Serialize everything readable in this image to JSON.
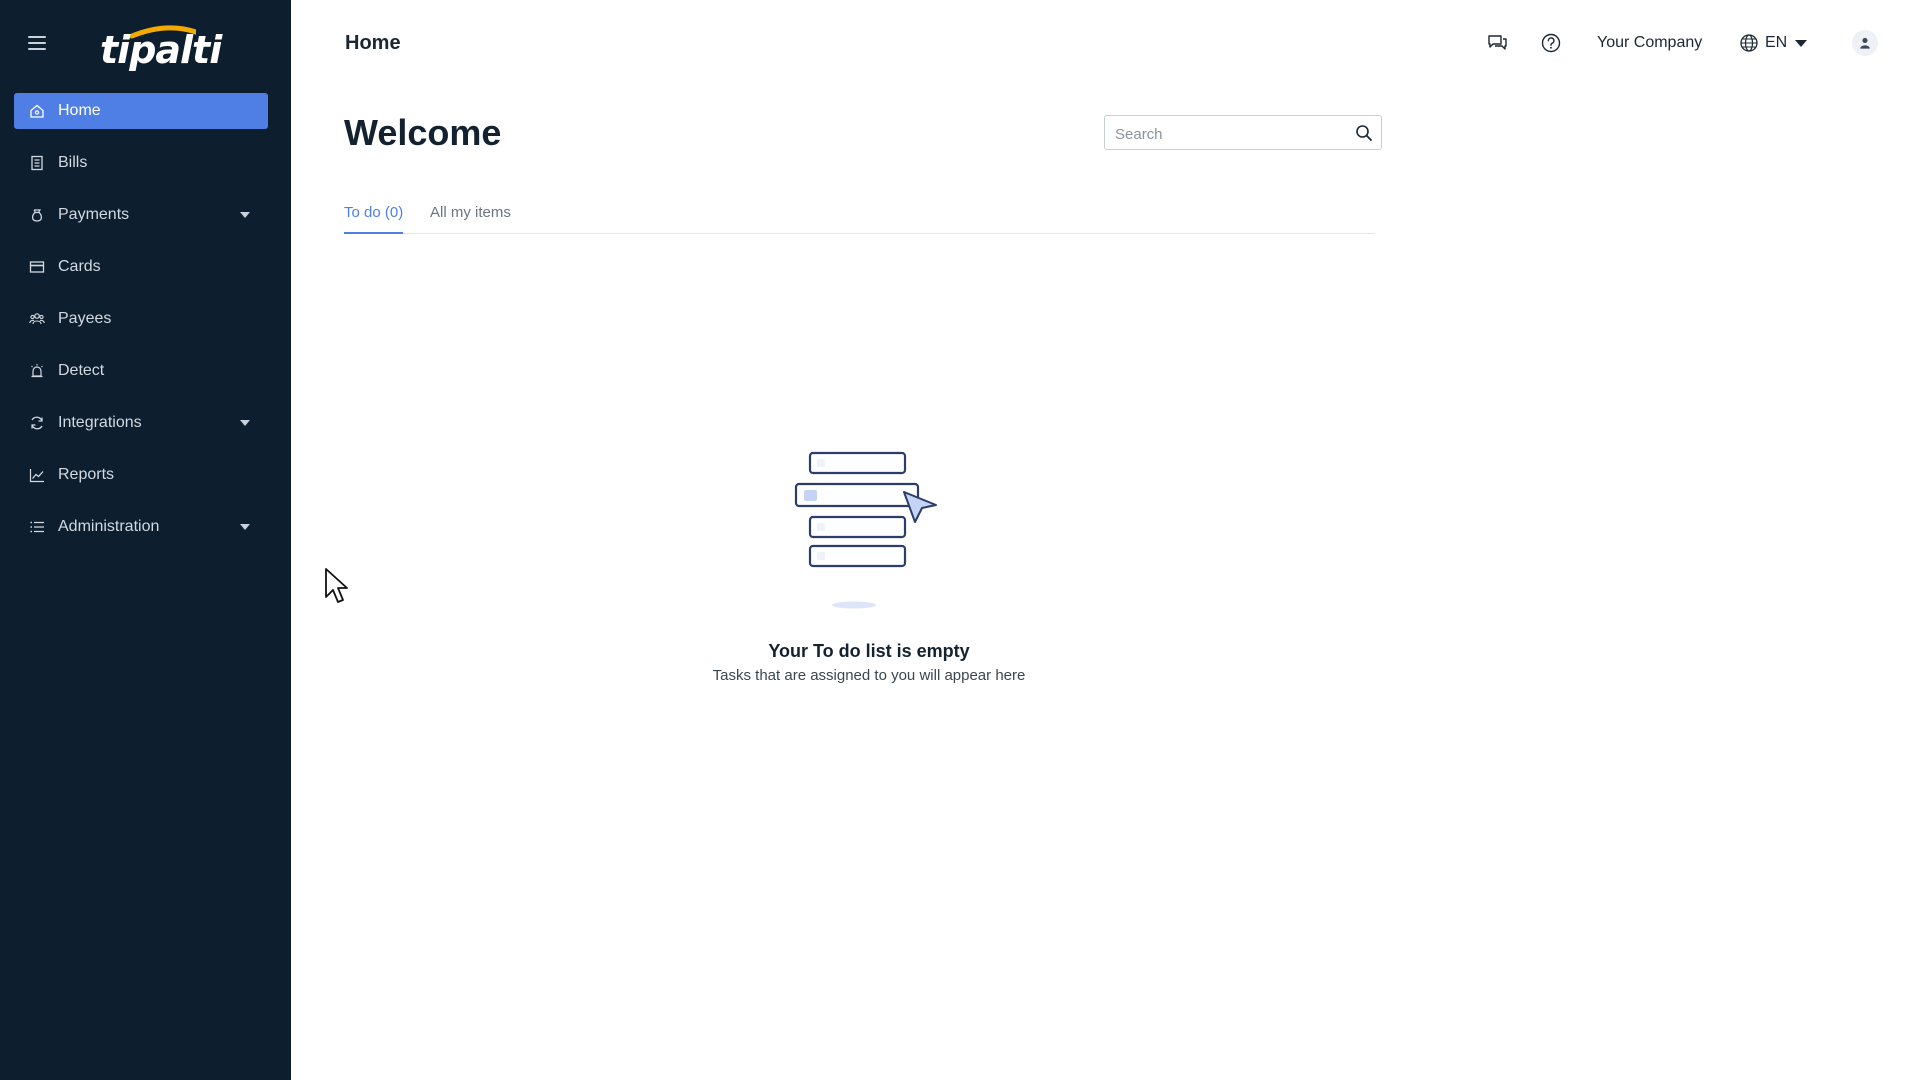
{
  "brand": {
    "logo_text": "tipalti",
    "accent": "#4f7fe5",
    "logo_arc_color": "#f2a900"
  },
  "sidebar": {
    "items": [
      {
        "label": "Home",
        "icon": "home-icon",
        "active": true,
        "has_submenu": false
      },
      {
        "label": "Bills",
        "icon": "bills-icon",
        "active": false,
        "has_submenu": false
      },
      {
        "label": "Payments",
        "icon": "payments-icon",
        "active": false,
        "has_submenu": true
      },
      {
        "label": "Cards",
        "icon": "card-icon",
        "active": false,
        "has_submenu": false
      },
      {
        "label": "Payees",
        "icon": "payees-icon",
        "active": false,
        "has_submenu": false
      },
      {
        "label": "Detect",
        "icon": "detect-icon",
        "active": false,
        "has_submenu": false
      },
      {
        "label": "Integrations",
        "icon": "integrations-icon",
        "active": false,
        "has_submenu": true
      },
      {
        "label": "Reports",
        "icon": "reports-icon",
        "active": false,
        "has_submenu": false
      },
      {
        "label": "Administration",
        "icon": "administration-icon",
        "active": false,
        "has_submenu": true
      }
    ]
  },
  "header": {
    "title": "Home",
    "company": "Your Company",
    "language": "EN"
  },
  "main": {
    "welcome": "Welcome",
    "search": {
      "placeholder": "Search",
      "value": ""
    },
    "tabs": [
      {
        "label": "To do (0)",
        "active": true
      },
      {
        "label": "All my items",
        "active": false
      }
    ],
    "empty_state": {
      "title": "Your To do list is empty",
      "subtitle": "Tasks that are assigned to you will appear here"
    }
  }
}
